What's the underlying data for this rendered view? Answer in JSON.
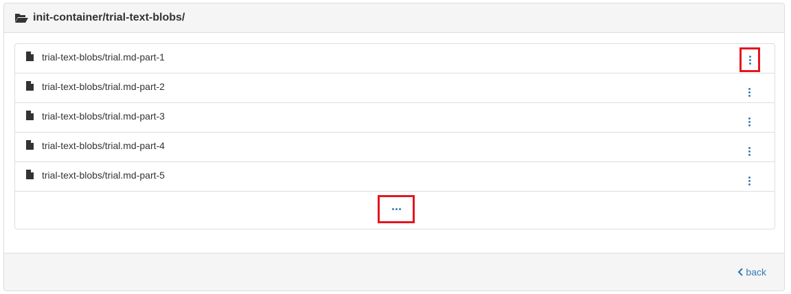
{
  "panel": {
    "title": "init-container/trial-text-blobs/",
    "folder_icon": "folder-open-icon"
  },
  "files": [
    {
      "name": "trial-text-blobs/trial.md-part-1",
      "icon": "file-icon",
      "highlighted": true
    },
    {
      "name": "trial-text-blobs/trial.md-part-2",
      "icon": "file-icon",
      "highlighted": false
    },
    {
      "name": "trial-text-blobs/trial.md-part-3",
      "icon": "file-icon",
      "highlighted": false
    },
    {
      "name": "trial-text-blobs/trial.md-part-4",
      "icon": "file-icon",
      "highlighted": false
    },
    {
      "name": "trial-text-blobs/trial.md-part-5",
      "icon": "file-icon",
      "highlighted": false
    }
  ],
  "load_more": {
    "icon": "ellipsis-icon",
    "highlighted": true
  },
  "footer": {
    "back_label": "back",
    "back_icon": "chevron-left-icon"
  },
  "colors": {
    "link": "#337ab7",
    "highlight": "#e5141e",
    "text": "#333333",
    "header_bg": "#f5f5f5",
    "border": "#dddddd"
  }
}
